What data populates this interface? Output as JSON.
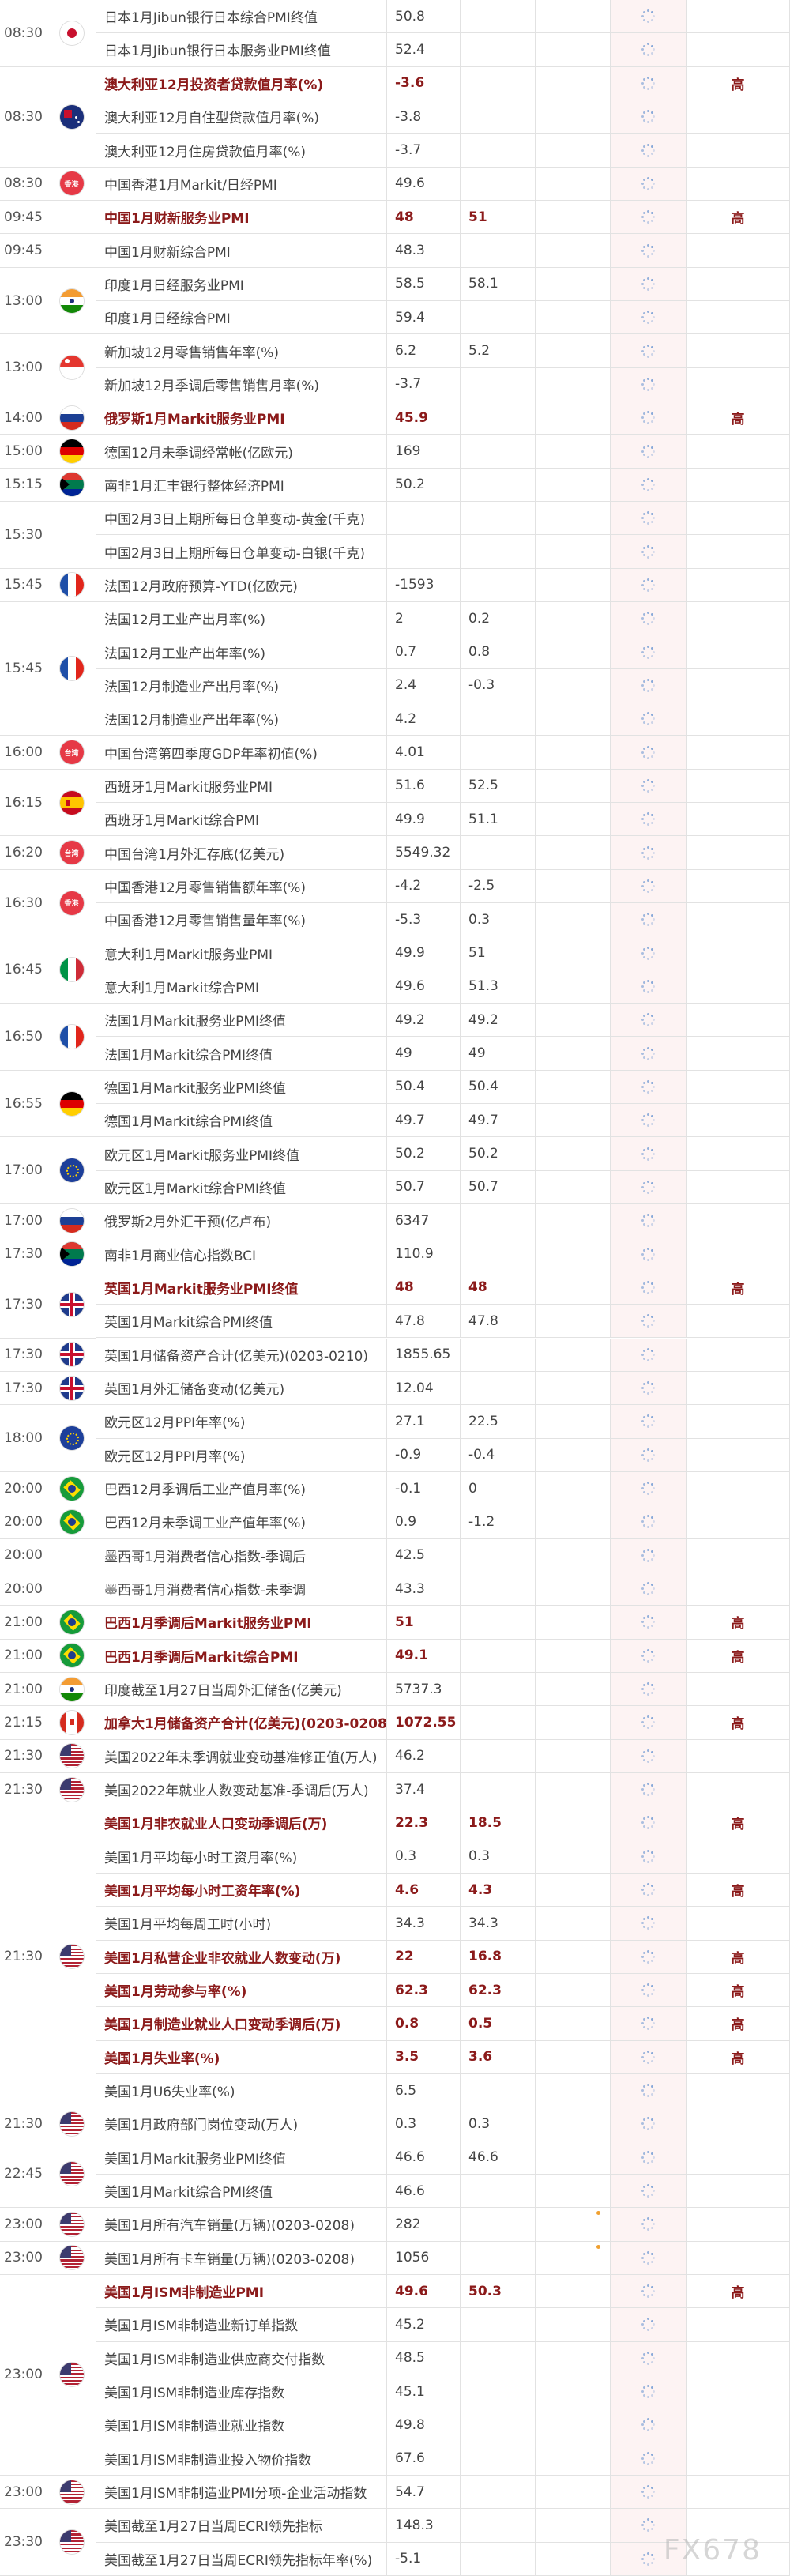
{
  "watermark": "FX678",
  "rows": [
    {
      "name": "日本1月Jibun银行日本综合PMI终值",
      "prev": "50.8",
      "fore": "",
      "act": "",
      "imp": ""
    },
    {
      "name": "日本1月Jibun银行日本服务业PMI终值",
      "prev": "52.4",
      "fore": "",
      "act": "",
      "imp": ""
    },
    {
      "name": "澳大利亚12月投资者贷款值月率(%)",
      "prev": "-3.6",
      "fore": "",
      "act": "",
      "imp": "高",
      "bold": true
    },
    {
      "name": "澳大利亚12月自住型贷款值月率(%)",
      "prev": "-3.8",
      "fore": "",
      "act": "",
      "imp": ""
    },
    {
      "name": "澳大利亚12月住房贷款值月率(%)",
      "prev": "-3.7",
      "fore": "",
      "act": "",
      "imp": ""
    },
    {
      "name": "中国香港1月Markit/日经PMI",
      "prev": "49.6",
      "fore": "",
      "act": "",
      "imp": ""
    },
    {
      "name": "中国1月财新服务业PMI",
      "prev": "48",
      "fore": "51",
      "act": "",
      "imp": "高",
      "bold": true
    },
    {
      "name": "中国1月财新综合PMI",
      "prev": "48.3",
      "fore": "",
      "act": "",
      "imp": ""
    },
    {
      "name": "印度1月日经服务业PMI",
      "prev": "58.5",
      "fore": "58.1",
      "act": "",
      "imp": ""
    },
    {
      "name": "印度1月日经综合PMI",
      "prev": "59.4",
      "fore": "",
      "act": "",
      "imp": ""
    },
    {
      "name": "新加坡12月零售销售年率(%)",
      "prev": "6.2",
      "fore": "5.2",
      "act": "",
      "imp": ""
    },
    {
      "name": "新加坡12月季调后零售销售月率(%)",
      "prev": "-3.7",
      "fore": "",
      "act": "",
      "imp": ""
    },
    {
      "name": "俄罗斯1月Markit服务业PMI",
      "prev": "45.9",
      "fore": "",
      "act": "",
      "imp": "高",
      "bold": true
    },
    {
      "name": "德国12月未季调经常帐(亿欧元)",
      "prev": "169",
      "fore": "",
      "act": "",
      "imp": ""
    },
    {
      "name": "南非1月汇丰银行整体经济PMI",
      "prev": "50.2",
      "fore": "",
      "act": "",
      "imp": ""
    },
    {
      "name": "中国2月3日上期所每日仓单变动-黄金(千克)",
      "prev": "",
      "fore": "",
      "act": "",
      "imp": ""
    },
    {
      "name": "中国2月3日上期所每日仓单变动-白银(千克)",
      "prev": "",
      "fore": "",
      "act": "",
      "imp": ""
    },
    {
      "name": "法国12月政府预算-YTD(亿欧元)",
      "prev": "-1593",
      "fore": "",
      "act": "",
      "imp": ""
    },
    {
      "name": "法国12月工业产出月率(%)",
      "prev": "2",
      "fore": "0.2",
      "act": "",
      "imp": ""
    },
    {
      "name": "法国12月工业产出年率(%)",
      "prev": "0.7",
      "fore": "0.8",
      "act": "",
      "imp": ""
    },
    {
      "name": "法国12月制造业产出月率(%)",
      "prev": "2.4",
      "fore": "-0.3",
      "act": "",
      "imp": ""
    },
    {
      "name": "法国12月制造业产出年率(%)",
      "prev": "4.2",
      "fore": "",
      "act": "",
      "imp": ""
    },
    {
      "name": "中国台湾第四季度GDP年率初值(%)",
      "prev": "4.01",
      "fore": "",
      "act": "",
      "imp": ""
    },
    {
      "name": "西班牙1月Markit服务业PMI",
      "prev": "51.6",
      "fore": "52.5",
      "act": "",
      "imp": ""
    },
    {
      "name": "西班牙1月Markit综合PMI",
      "prev": "49.9",
      "fore": "51.1",
      "act": "",
      "imp": ""
    },
    {
      "name": "中国台湾1月外汇存底(亿美元)",
      "prev": "5549.32",
      "fore": "",
      "act": "",
      "imp": ""
    },
    {
      "name": "中国香港12月零售销售额年率(%)",
      "prev": "-4.2",
      "fore": "-2.5",
      "act": "",
      "imp": ""
    },
    {
      "name": "中国香港12月零售销售量年率(%)",
      "prev": "-5.3",
      "fore": "0.3",
      "act": "",
      "imp": ""
    },
    {
      "name": "意大利1月Markit服务业PMI",
      "prev": "49.9",
      "fore": "51",
      "act": "",
      "imp": ""
    },
    {
      "name": "意大利1月Markit综合PMI",
      "prev": "49.6",
      "fore": "51.3",
      "act": "",
      "imp": ""
    },
    {
      "name": "法国1月Markit服务业PMI终值",
      "prev": "49.2",
      "fore": "49.2",
      "act": "",
      "imp": ""
    },
    {
      "name": "法国1月Markit综合PMI终值",
      "prev": "49",
      "fore": "49",
      "act": "",
      "imp": ""
    },
    {
      "name": "德国1月Markit服务业PMI终值",
      "prev": "50.4",
      "fore": "50.4",
      "act": "",
      "imp": ""
    },
    {
      "name": "德国1月Markit综合PMI终值",
      "prev": "49.7",
      "fore": "49.7",
      "act": "",
      "imp": ""
    },
    {
      "name": "欧元区1月Markit服务业PMI终值",
      "prev": "50.2",
      "fore": "50.2",
      "act": "",
      "imp": ""
    },
    {
      "name": "欧元区1月Markit综合PMI终值",
      "prev": "50.7",
      "fore": "50.7",
      "act": "",
      "imp": ""
    },
    {
      "name": "俄罗斯2月外汇干预(亿卢布)",
      "prev": "6347",
      "fore": "",
      "act": "",
      "imp": ""
    },
    {
      "name": "南非1月商业信心指数BCI",
      "prev": "110.9",
      "fore": "",
      "act": "",
      "imp": ""
    },
    {
      "name": "英国1月Markit服务业PMI终值",
      "prev": "48",
      "fore": "48",
      "act": "",
      "imp": "高",
      "bold": true
    },
    {
      "name": "英国1月Markit综合PMI终值",
      "prev": "47.8",
      "fore": "47.8",
      "act": "",
      "imp": ""
    },
    {
      "name": "英国1月储备资产合计(亿美元)(0203-0210)",
      "prev": "1855.65",
      "fore": "",
      "act": "",
      "imp": ""
    },
    {
      "name": "英国1月外汇储备变动(亿美元)",
      "prev": "12.04",
      "fore": "",
      "act": "",
      "imp": ""
    },
    {
      "name": "欧元区12月PPI年率(%)",
      "prev": "27.1",
      "fore": "22.5",
      "act": "",
      "imp": ""
    },
    {
      "name": "欧元区12月PPI月率(%)",
      "prev": "-0.9",
      "fore": "-0.4",
      "act": "",
      "imp": ""
    },
    {
      "name": "巴西12月季调后工业产值月率(%)",
      "prev": "-0.1",
      "fore": "0",
      "act": "",
      "imp": ""
    },
    {
      "name": "巴西12月未季调工业产值年率(%)",
      "prev": "0.9",
      "fore": "-1.2",
      "act": "",
      "imp": ""
    },
    {
      "name": "墨西哥1月消费者信心指数-季调后",
      "prev": "42.5",
      "fore": "",
      "act": "",
      "imp": ""
    },
    {
      "name": "墨西哥1月消费者信心指数-未季调",
      "prev": "43.3",
      "fore": "",
      "act": "",
      "imp": ""
    },
    {
      "name": "巴西1月季调后Markit服务业PMI",
      "prev": "51",
      "fore": "",
      "act": "",
      "imp": "高",
      "bold": true
    },
    {
      "name": "巴西1月季调后Markit综合PMI",
      "prev": "49.1",
      "fore": "",
      "act": "",
      "imp": "高",
      "bold": true
    },
    {
      "name": "印度截至1月27日当周外汇储备(亿美元)",
      "prev": "5737.3",
      "fore": "",
      "act": "",
      "imp": ""
    },
    {
      "name": "加拿大1月储备资产合计(亿美元)(0203-0208)",
      "prev": "1072.55",
      "fore": "",
      "act": "",
      "imp": "高",
      "bold": true
    },
    {
      "name": "美国2022年未季调就业变动基准修正值(万人)",
      "prev": "46.2",
      "fore": "",
      "act": "",
      "imp": ""
    },
    {
      "name": "美国2022年就业人数变动基准-季调后(万人)",
      "prev": "37.4",
      "fore": "",
      "act": "",
      "imp": ""
    },
    {
      "name": "美国1月非农就业人口变动季调后(万)",
      "prev": "22.3",
      "fore": "18.5",
      "act": "",
      "imp": "高",
      "bold": true
    },
    {
      "name": "美国1月平均每小时工资月率(%)",
      "prev": "0.3",
      "fore": "0.3",
      "act": "",
      "imp": ""
    },
    {
      "name": "美国1月平均每小时工资年率(%)",
      "prev": "4.6",
      "fore": "4.3",
      "act": "",
      "imp": "高",
      "bold": true
    },
    {
      "name": "美国1月平均每周工时(小时)",
      "prev": "34.3",
      "fore": "34.3",
      "act": "",
      "imp": ""
    },
    {
      "name": "美国1月私营企业非农就业人数变动(万)",
      "prev": "22",
      "fore": "16.8",
      "act": "",
      "imp": "高",
      "bold": true
    },
    {
      "name": "美国1月劳动参与率(%)",
      "prev": "62.3",
      "fore": "62.3",
      "act": "",
      "imp": "高",
      "bold": true
    },
    {
      "name": "美国1月制造业就业人口变动季调后(万)",
      "prev": "0.8",
      "fore": "0.5",
      "act": "",
      "imp": "高",
      "bold": true
    },
    {
      "name": "美国1月失业率(%)",
      "prev": "3.5",
      "fore": "3.6",
      "act": "",
      "imp": "高",
      "bold": true
    },
    {
      "name": "美国1月U6失业率(%)",
      "prev": "6.5",
      "fore": "",
      "act": "",
      "imp": ""
    },
    {
      "name": "美国1月政府部门岗位变动(万人)",
      "prev": "0.3",
      "fore": "0.3",
      "act": "",
      "imp": ""
    },
    {
      "name": "美国1月Markit服务业PMI终值",
      "prev": "46.6",
      "fore": "46.6",
      "act": "",
      "imp": ""
    },
    {
      "name": "美国1月Markit综合PMI终值",
      "prev": "46.6",
      "fore": "",
      "act": "",
      "imp": ""
    },
    {
      "name": "美国1月所有汽车销量(万辆)(0203-0208)",
      "prev": "282",
      "fore": "",
      "act": "",
      "imp": "",
      "dot": true
    },
    {
      "name": "美国1月所有卡车销量(万辆)(0203-0208)",
      "prev": "1056",
      "fore": "",
      "act": "",
      "imp": "",
      "dot": true
    },
    {
      "name": "美国1月ISM非制造业PMI",
      "prev": "49.6",
      "fore": "50.3",
      "act": "",
      "imp": "高",
      "bold": true
    },
    {
      "name": "美国1月ISM非制造业新订单指数",
      "prev": "45.2",
      "fore": "",
      "act": "",
      "imp": ""
    },
    {
      "name": "美国1月ISM非制造业供应商交付指数",
      "prev": "48.5",
      "fore": "",
      "act": "",
      "imp": ""
    },
    {
      "name": "美国1月ISM非制造业库存指数",
      "prev": "45.1",
      "fore": "",
      "act": "",
      "imp": ""
    },
    {
      "name": "美国1月ISM非制造业就业指数",
      "prev": "49.8",
      "fore": "",
      "act": "",
      "imp": ""
    },
    {
      "name": "美国1月ISM非制造业投入物价指数",
      "prev": "67.6",
      "fore": "",
      "act": "",
      "imp": ""
    },
    {
      "name": "美国1月ISM非制造业PMI分项-企业活动指数",
      "prev": "54.7",
      "fore": "",
      "act": "",
      "imp": ""
    },
    {
      "name": "美国截至1月27日当周ECRI领先指标",
      "prev": "148.3",
      "fore": "",
      "act": "",
      "imp": ""
    },
    {
      "name": "美国截至1月27日当周ECRI领先指标年率(%)",
      "prev": "-5.1",
      "fore": "",
      "act": "",
      "imp": ""
    }
  ],
  "groups": [
    {
      "time": "08:30",
      "flag": "japan-flag",
      "rows": 2
    },
    {
      "time": "08:30",
      "flag": "australia-flag",
      "rows": 3
    },
    {
      "time": "08:30",
      "flag": "hongkong-flag",
      "label": "香港",
      "rows": 1
    },
    {
      "time": "09:45",
      "flag": "",
      "rows": 1
    },
    {
      "time": "09:45",
      "flag": "",
      "rows": 1
    },
    {
      "time": "13:00",
      "flag": "india-flag",
      "rows": 2
    },
    {
      "time": "13:00",
      "flag": "singapore-flag",
      "rows": 2
    },
    {
      "time": "14:00",
      "flag": "russia-flag",
      "rows": 1
    },
    {
      "time": "15:00",
      "flag": "germany-flag",
      "rows": 1
    },
    {
      "time": "15:15",
      "flag": "southafrica-flag",
      "rows": 1
    },
    {
      "time": "15:30",
      "flag": "",
      "rows": 2
    },
    {
      "time": "15:45",
      "flag": "france-flag",
      "rows": 1
    },
    {
      "time": "15:45",
      "flag": "france-flag",
      "rows": 4
    },
    {
      "time": "16:00",
      "flag": "taiwan-flag",
      "label": "台湾",
      "rows": 1
    },
    {
      "time": "16:15",
      "flag": "spain-flag",
      "rows": 2
    },
    {
      "time": "16:20",
      "flag": "taiwan-flag",
      "label": "台湾",
      "rows": 1
    },
    {
      "time": "16:30",
      "flag": "hongkong-flag",
      "label": "香港",
      "rows": 2
    },
    {
      "time": "16:45",
      "flag": "italy-flag",
      "rows": 2
    },
    {
      "time": "16:50",
      "flag": "france-flag",
      "rows": 2
    },
    {
      "time": "16:55",
      "flag": "germany-flag",
      "rows": 2
    },
    {
      "time": "17:00",
      "flag": "eu-flag",
      "rows": 2
    },
    {
      "time": "17:00",
      "flag": "russia-flag",
      "rows": 1
    },
    {
      "time": "17:30",
      "flag": "southafrica-flag",
      "rows": 1
    },
    {
      "time": "17:30",
      "flag": "uk-flag",
      "rows": 2
    },
    {
      "time": "17:30",
      "flag": "uk-flag",
      "rows": 1
    },
    {
      "time": "17:30",
      "flag": "uk-flag",
      "rows": 1
    },
    {
      "time": "18:00",
      "flag": "eu-flag",
      "rows": 2
    },
    {
      "time": "20:00",
      "flag": "brazil-flag",
      "rows": 1
    },
    {
      "time": "20:00",
      "flag": "brazil-flag",
      "rows": 1
    },
    {
      "time": "20:00",
      "flag": "",
      "rows": 1
    },
    {
      "time": "20:00",
      "flag": "",
      "rows": 1
    },
    {
      "time": "21:00",
      "flag": "brazil-flag",
      "rows": 1
    },
    {
      "time": "21:00",
      "flag": "brazil-flag",
      "rows": 1
    },
    {
      "time": "21:00",
      "flag": "india-flag",
      "rows": 1
    },
    {
      "time": "21:15",
      "flag": "canada-flag",
      "rows": 1
    },
    {
      "time": "21:30",
      "flag": "usa-flag",
      "rows": 1
    },
    {
      "time": "21:30",
      "flag": "usa-flag",
      "rows": 1
    },
    {
      "time": "21:30",
      "flag": "usa-flag",
      "rows": 9
    },
    {
      "time": "21:30",
      "flag": "usa-flag",
      "rows": 1
    },
    {
      "time": "22:45",
      "flag": "usa-flag",
      "rows": 2
    },
    {
      "time": "23:00",
      "flag": "usa-flag",
      "rows": 1
    },
    {
      "time": "23:00",
      "flag": "usa-flag",
      "rows": 1
    },
    {
      "time": "23:00",
      "flag": "usa-flag",
      "rows": 6
    },
    {
      "time": "23:00",
      "flag": "usa-flag",
      "rows": 1
    },
    {
      "time": "23:30",
      "flag": "usa-flag",
      "rows": 2
    }
  ],
  "colors": {
    "important": "#8b1a1a",
    "favorite_bg": "#fdf3f3",
    "border": "#e2e2e2",
    "dot": "#f0a030"
  }
}
